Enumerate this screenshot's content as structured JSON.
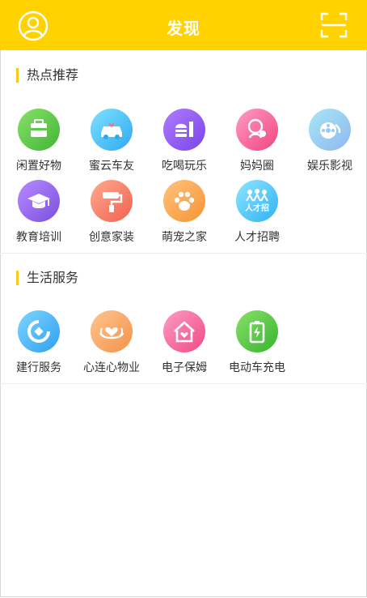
{
  "header": {
    "title": "发现"
  },
  "hot": {
    "title": "热点推荐",
    "items": [
      {
        "label": "闲置好物",
        "icon": "bag-icon"
      },
      {
        "label": "蜜云车友",
        "icon": "car-icon"
      },
      {
        "label": "吃喝玩乐",
        "icon": "burger-icon"
      },
      {
        "label": "妈妈圈",
        "icon": "mother-icon"
      },
      {
        "label": "娱乐影视",
        "icon": "film-reel-icon"
      },
      {
        "label": "教育培训",
        "icon": "graduation-cap-icon"
      },
      {
        "label": "创意家装",
        "icon": "paint-roller-icon"
      },
      {
        "label": "萌宠之家",
        "icon": "paw-icon"
      },
      {
        "label": "人才招聘",
        "icon": "people-icon",
        "badge": "人才招"
      }
    ]
  },
  "life": {
    "title": "生活服务",
    "items": [
      {
        "label": "建行服务",
        "icon": "ccb-logo-icon"
      },
      {
        "label": "心连心物业",
        "icon": "hands-heart-icon"
      },
      {
        "label": "电子保姆",
        "icon": "heart-home-icon"
      },
      {
        "label": "电动车充电",
        "icon": "battery-charging-icon"
      }
    ]
  }
}
